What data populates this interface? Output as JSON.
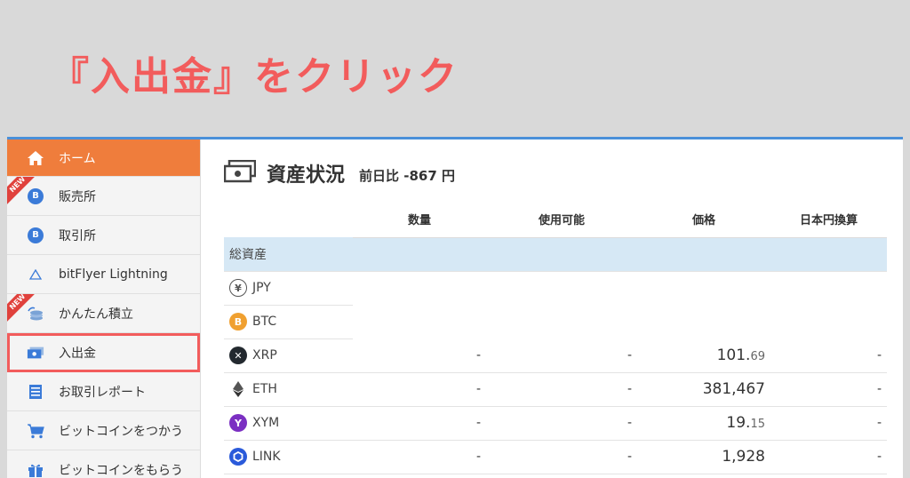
{
  "instruction": "『入出金』をクリック",
  "colors": {
    "accent": "#ef7d3c",
    "highlight": "#f25c5c",
    "header_rule": "#4a90d9",
    "total_row": "#d6e8f5"
  },
  "sidebar": {
    "items": [
      {
        "label": "ホーム",
        "icon": "home-icon"
      },
      {
        "label": "販売所",
        "icon": "bitcoin-icon",
        "badge": "NEW"
      },
      {
        "label": "取引所",
        "icon": "bitcoin-icon"
      },
      {
        "label": "bitFlyer Lightning",
        "icon": "lightning-triangle-icon"
      },
      {
        "label": "かんたん積立",
        "icon": "coin-stack-icon",
        "badge": "NEW"
      },
      {
        "label": "入出金",
        "icon": "money-icon"
      },
      {
        "label": "お取引レポート",
        "icon": "report-icon"
      },
      {
        "label": "ビットコインをつかう",
        "icon": "cart-icon"
      },
      {
        "label": "ビットコインをもらう",
        "icon": "gift-icon"
      }
    ]
  },
  "main": {
    "title": "資産状況",
    "delta_label": "前日比",
    "delta_value": "-867",
    "delta_unit": "円",
    "columns": [
      "数量",
      "使用可能",
      "価格",
      "日本円換算"
    ],
    "total_label": "総資産",
    "rows": [
      {
        "symbol": "JPY",
        "icon": "yen-icon",
        "qty": "",
        "avail": "",
        "price_int": "",
        "price_dec": "",
        "jpy": ""
      },
      {
        "symbol": "BTC",
        "icon": "bitcoin-icon",
        "qty": "",
        "avail": "",
        "price_int": "",
        "price_dec": "",
        "jpy": ""
      },
      {
        "symbol": "XRP",
        "icon": "xrp-icon",
        "qty": "-",
        "avail": "-",
        "price_int": "101.",
        "price_dec": "69",
        "jpy": "-"
      },
      {
        "symbol": "ETH",
        "icon": "ethereum-icon",
        "qty": "-",
        "avail": "-",
        "price_int": "381,467",
        "price_dec": "",
        "jpy": "-"
      },
      {
        "symbol": "XYM",
        "icon": "symbol-icon",
        "qty": "-",
        "avail": "-",
        "price_int": "19.",
        "price_dec": "15",
        "jpy": "-"
      },
      {
        "symbol": "LINK",
        "icon": "chainlink-icon",
        "qty": "-",
        "avail": "-",
        "price_int": "1,928",
        "price_dec": "",
        "jpy": "-"
      }
    ]
  }
}
